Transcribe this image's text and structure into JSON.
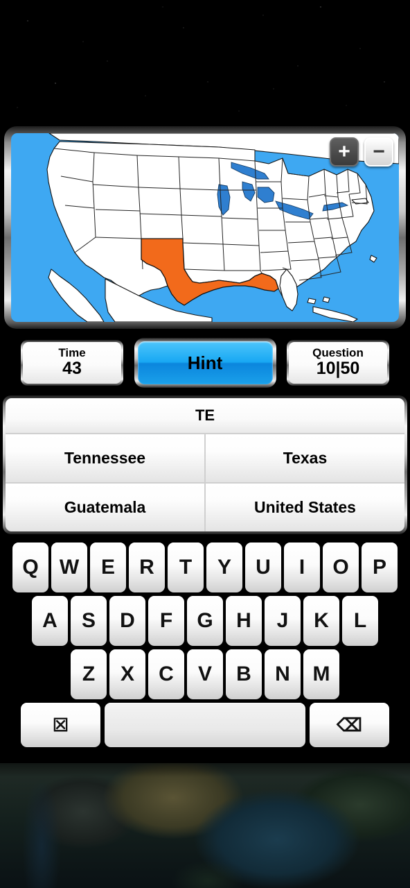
{
  "background": {
    "top": "starfield",
    "bottom": "earth-satellite-view"
  },
  "map": {
    "name": "united-states-map",
    "ocean_color": "#3EA8F2",
    "land_color": "#FFFFFF",
    "border_color": "#000000",
    "highlight_color": "#F26A1B",
    "highlighted_region": "Texas",
    "zoom_in_label": "+",
    "zoom_out_label": "−"
  },
  "status": {
    "time": {
      "label": "Time",
      "value": "43"
    },
    "hint": {
      "label": "Hint",
      "color": "#18A8F3"
    },
    "question": {
      "label": "Question",
      "value": "10|50"
    }
  },
  "answers": {
    "typed_text": "TE",
    "options": [
      [
        "Tennessee",
        "Texas"
      ],
      [
        "Guatemala",
        "United States"
      ]
    ]
  },
  "keyboard": {
    "row1": [
      "Q",
      "W",
      "E",
      "R",
      "T",
      "Y",
      "U",
      "I",
      "O",
      "P"
    ],
    "row2": [
      "A",
      "S",
      "D",
      "F",
      "G",
      "H",
      "J",
      "K",
      "L"
    ],
    "row3": [
      "Z",
      "X",
      "C",
      "V",
      "B",
      "N",
      "M"
    ],
    "clear_key": "☒",
    "space_key": "",
    "backspace_key": "⌫"
  }
}
